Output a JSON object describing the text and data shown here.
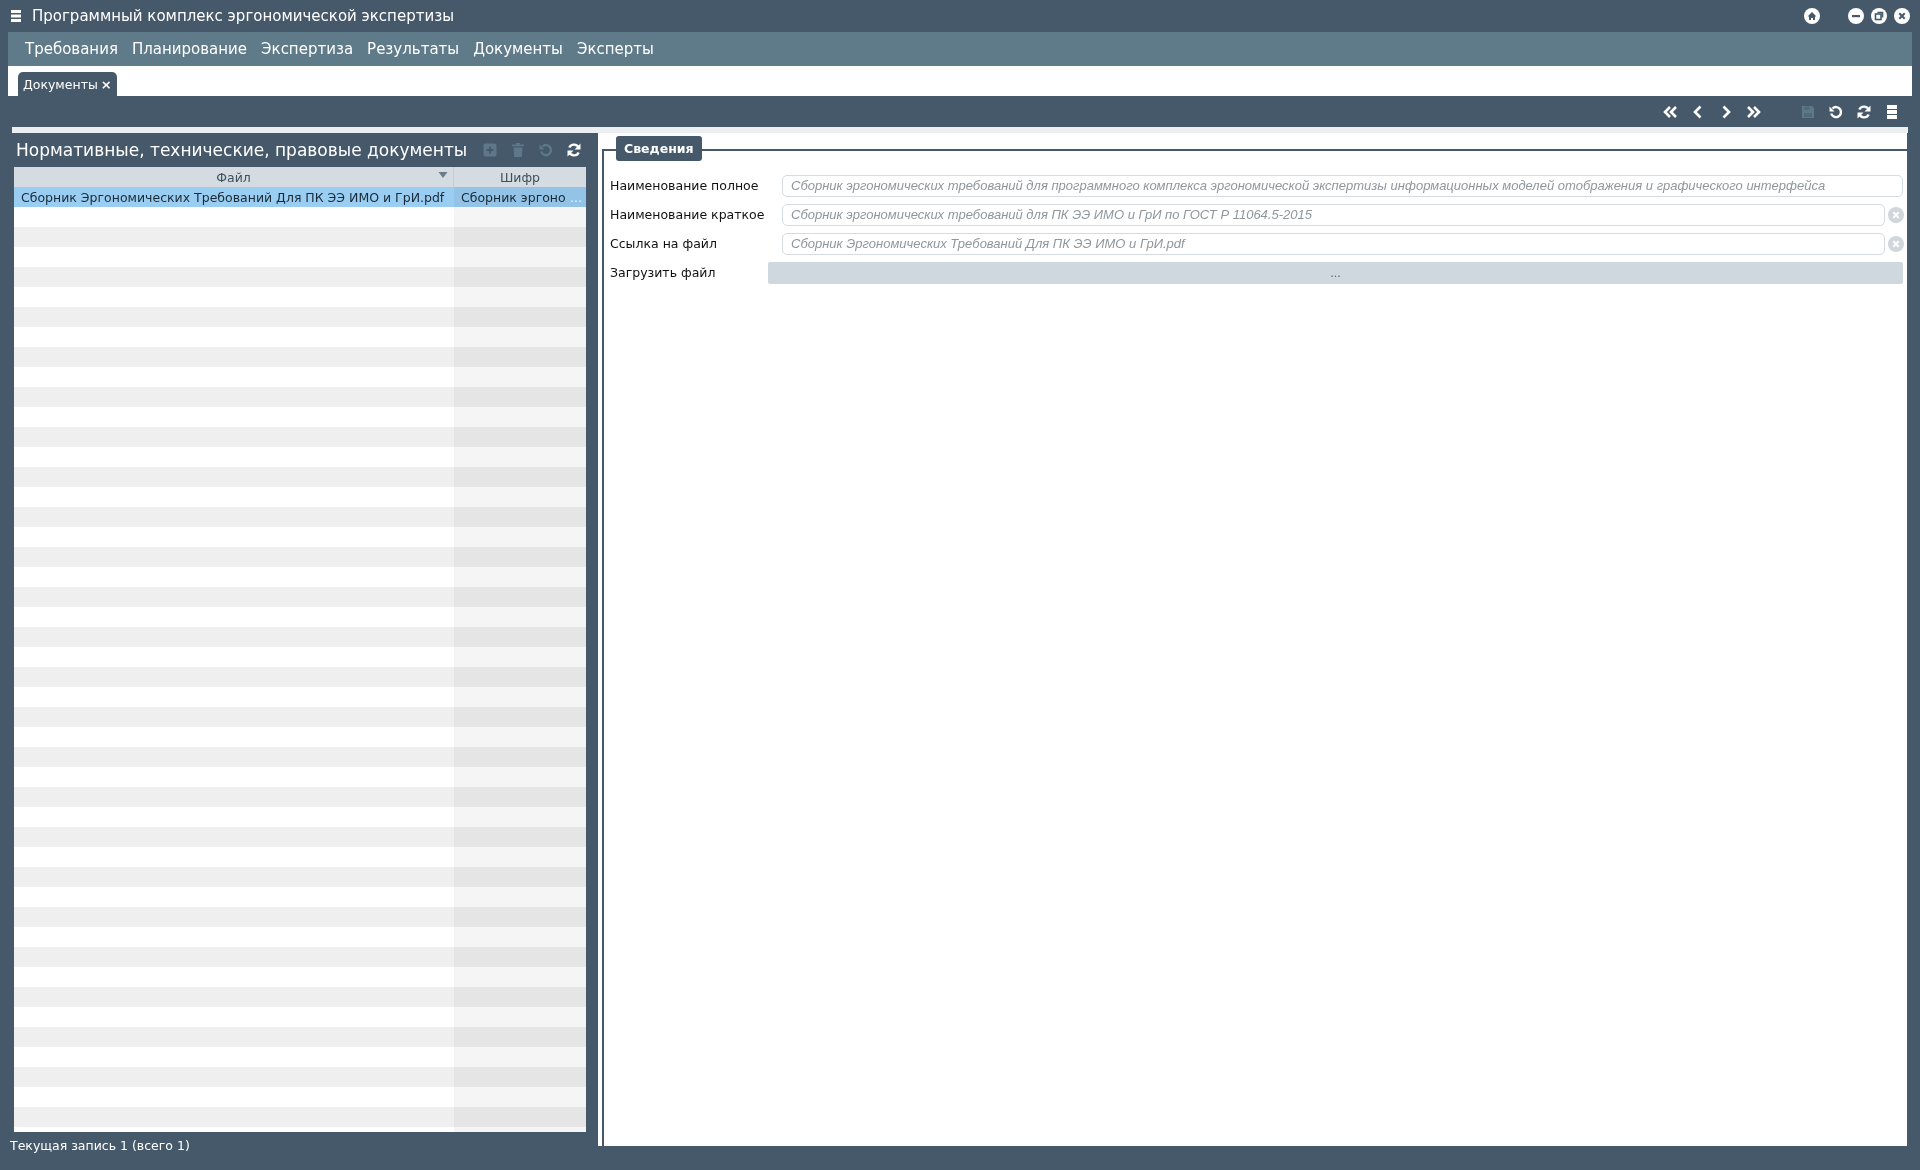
{
  "window": {
    "title": "Программный комплекс эргономической экспертизы",
    "controls": [
      {
        "kind": "home"
      },
      {
        "kind": "minimize"
      },
      {
        "kind": "restore"
      },
      {
        "kind": "close"
      }
    ]
  },
  "menu": [
    "Требования",
    "Планирование",
    "Экспертиза",
    "Результаты",
    "Документы",
    "Эксперты"
  ],
  "tabs": [
    {
      "label": "Документы",
      "close": "×",
      "selected": true
    }
  ],
  "toolbar": [
    {
      "kind": "first",
      "disabled": false
    },
    {
      "kind": "prev",
      "disabled": false
    },
    {
      "kind": "next",
      "disabled": false
    },
    {
      "kind": "last",
      "disabled": false
    },
    {
      "kind": "save",
      "disabled": true
    },
    {
      "kind": "undo",
      "disabled": false
    },
    {
      "kind": "refresh",
      "disabled": false
    },
    {
      "kind": "layout",
      "disabled": false
    }
  ],
  "list_panel": {
    "title": "Нормативные, технические, правовые документы",
    "actions": [
      {
        "kind": "add",
        "disabled": true
      },
      {
        "kind": "delete",
        "disabled": true
      },
      {
        "kind": "undo",
        "disabled": true
      },
      {
        "kind": "refresh",
        "disabled": false
      }
    ],
    "columns": [
      {
        "label": "Файл",
        "sorted": true
      },
      {
        "label": "Шифр",
        "sorted": false
      }
    ],
    "rows": [
      {
        "cells": [
          "Сборник Эргономических Требований Для ПК ЭЭ ИМО и ГрИ.pdf",
          "Сборник эргоно"
        ],
        "more": "...",
        "selected": true
      }
    ],
    "status": "Текущая запись 1 (всего 1)"
  },
  "details": {
    "legend": "Сведения",
    "fields": [
      {
        "kind": "text",
        "label": "Наименование полное",
        "placeholder": "Сборник эргономических требований для программного комплекса эргономической экспертизы информационных моделей отображения и графического интерфейса",
        "clearable": false
      },
      {
        "kind": "text",
        "label": "Наименование краткое",
        "placeholder": "Сборник эргономических требований для ПК ЭЭ ИМО и ГрИ по ГОСТ Р 11064.5-2015",
        "clearable": true
      },
      {
        "kind": "text",
        "label": "Ссылка на файл",
        "placeholder": "Сборник Эргономических Требований Для ПК ЭЭ ИМО и ГрИ.pdf",
        "clearable": true
      },
      {
        "kind": "upload",
        "label": "Загрузить файл",
        "button": "..."
      }
    ]
  }
}
